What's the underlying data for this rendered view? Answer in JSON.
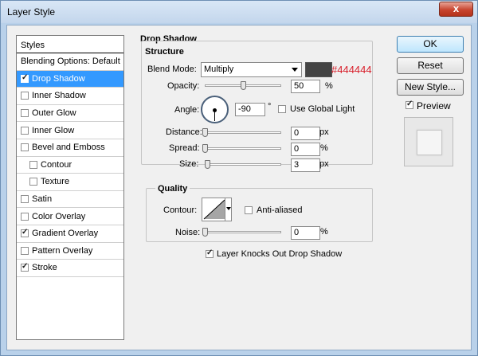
{
  "window": {
    "title": "Layer Style",
    "close_glyph": "x"
  },
  "styles_panel": {
    "header": "Styles",
    "blending_options": "Blending Options: Default",
    "items": [
      {
        "label": "Drop Shadow",
        "checked": true,
        "selected": true
      },
      {
        "label": "Inner Shadow",
        "checked": false
      },
      {
        "label": "Outer Glow",
        "checked": false
      },
      {
        "label": "Inner Glow",
        "checked": false
      },
      {
        "label": "Bevel and Emboss",
        "checked": false
      },
      {
        "label": "Contour",
        "checked": false,
        "sub": true
      },
      {
        "label": "Texture",
        "checked": false,
        "sub": true
      },
      {
        "label": "Satin",
        "checked": false
      },
      {
        "label": "Color Overlay",
        "checked": false
      },
      {
        "label": "Gradient Overlay",
        "checked": true
      },
      {
        "label": "Pattern Overlay",
        "checked": false
      },
      {
        "label": "Stroke",
        "checked": true
      }
    ]
  },
  "drop_shadow": {
    "title": "Drop Shadow",
    "structure": {
      "title": "Structure",
      "blend_mode_label": "Blend Mode:",
      "blend_mode_value": "Multiply",
      "color_hex": "#444444",
      "opacity_label": "Opacity:",
      "opacity_value": "50",
      "opacity_unit": "%",
      "opacity_fraction": 0.5,
      "angle_label": "Angle:",
      "angle_value": "-90",
      "angle_unit": "°",
      "use_global_light_label": "Use Global Light",
      "use_global_light_checked": false,
      "distance_label": "Distance:",
      "distance_value": "0",
      "distance_unit": "px",
      "spread_label": "Spread:",
      "spread_value": "0",
      "spread_unit": "%",
      "size_label": "Size:",
      "size_value": "3",
      "size_unit": "px"
    },
    "quality": {
      "title": "Quality",
      "contour_label": "Contour:",
      "anti_aliased_label": "Anti-aliased",
      "anti_aliased_checked": false,
      "noise_label": "Noise:",
      "noise_value": "0",
      "noise_unit": "%"
    },
    "knockout_label": "Layer Knocks Out Drop Shadow",
    "knockout_checked": true
  },
  "buttons": {
    "ok": "OK",
    "reset": "Reset",
    "new_style": "New Style...",
    "preview_label": "Preview",
    "preview_checked": true
  },
  "colors": {
    "selection": "#3399ff",
    "shadow_color": "#444444",
    "hex_text": "#d81e2a"
  }
}
